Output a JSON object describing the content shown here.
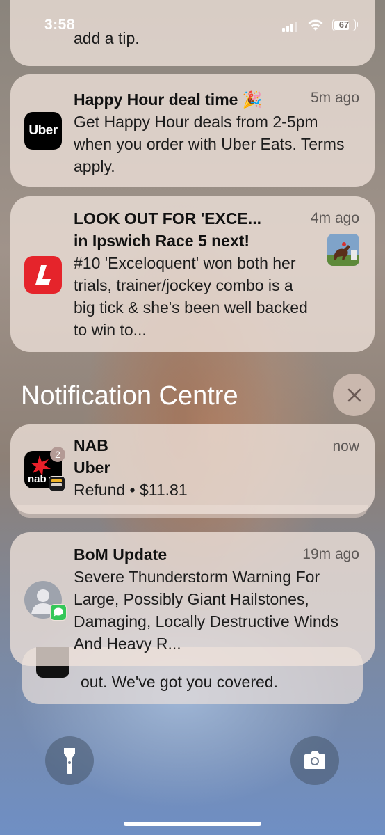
{
  "status_bar": {
    "time": "3:58",
    "battery": "67"
  },
  "partial_top_notification": {
    "body": "add a tip."
  },
  "notifications": [
    {
      "app": "Uber",
      "icon_label": "Uber",
      "title": "Happy Hour deal time 🎉",
      "time": "5m ago",
      "body": "Get Happy Hour deals from 2-5pm when you order with Uber Eats. Terms apply."
    },
    {
      "app": "Ladbrokes",
      "title_line1": "LOOK OUT FOR 'EXCE...",
      "title_line2": "in Ipswich Race 5 next!",
      "time": "4m ago",
      "body": "#10 'Exceloquent' won both her trials, trainer/jockey combo is a big tick & she's been well backed to win to..."
    }
  ],
  "notification_centre": {
    "heading": "Notification Centre",
    "items": [
      {
        "app": "NAB",
        "badge": "2",
        "icon_label": "nab",
        "title": "NAB",
        "subtitle": "Uber",
        "time": "now",
        "body": "Refund • $11.81"
      },
      {
        "app": "Messages",
        "title": "BoM Update",
        "time": "19m ago",
        "body": "Severe Thunderstorm Warning For Large, Possibly Giant Hailstones, Damaging, Locally Destructive Winds And Heavy R..."
      }
    ],
    "stacked_behind_body": "out. We've got you covered."
  },
  "colors": {
    "ladbrokes_red": "#e5242b",
    "nab_red": "#e8202a",
    "messages_green": "#34c759"
  },
  "icons": [
    "flashlight-icon",
    "camera-icon",
    "close-icon"
  ]
}
